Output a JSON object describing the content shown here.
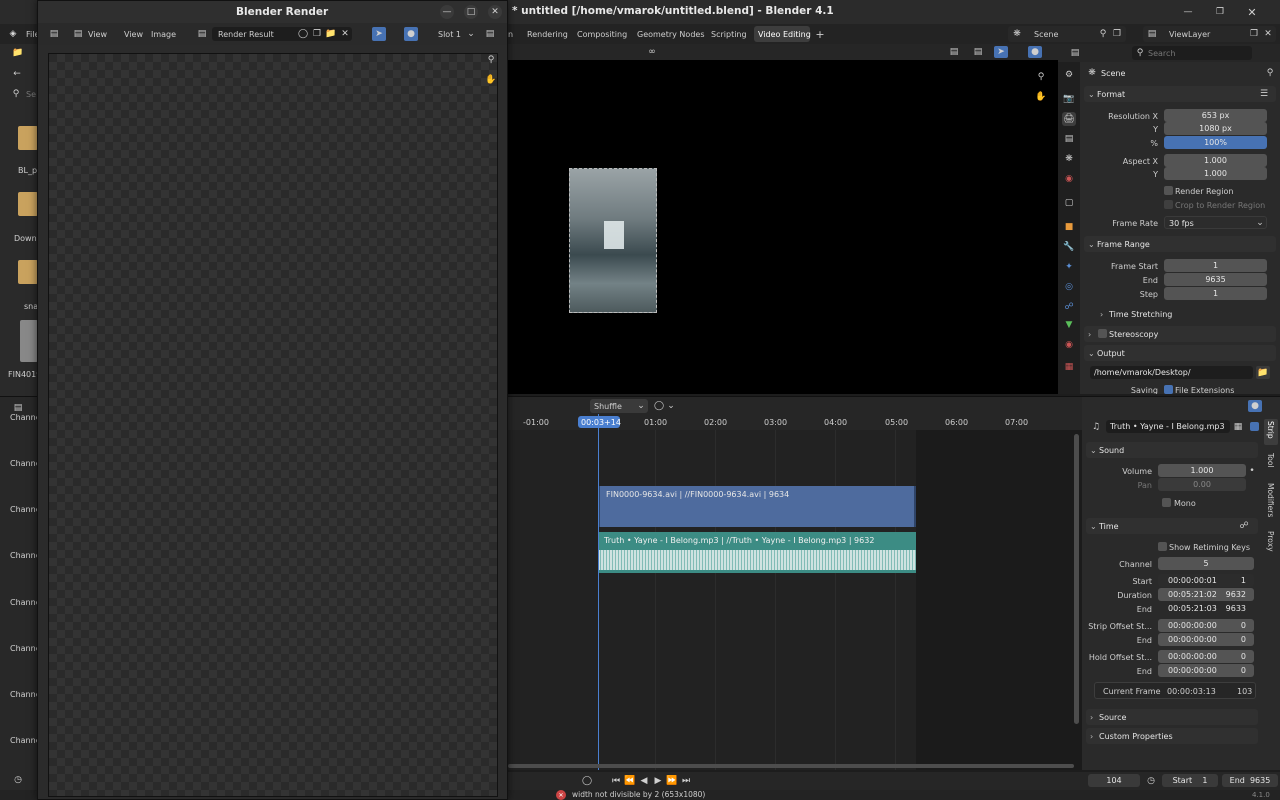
{
  "main_window": {
    "title": "* untitled [/home/vmarok/untitled.blend] - Blender 4.1",
    "workspaces": [
      "n",
      "Rendering",
      "Compositing",
      "Geometry Nodes",
      "Scripting",
      "Video Editing"
    ],
    "active_workspace": "Video Editing",
    "scene": "Scene",
    "view_layer": "ViewLayer"
  },
  "file_browser": {
    "menu_label": "File",
    "search_placeholder": "Se",
    "items": [
      "BL_pr",
      "Downl",
      "sna",
      "FIN4019"
    ]
  },
  "render_window": {
    "title": "Blender Render",
    "menu": [
      "View",
      "View",
      "Image"
    ],
    "image_name": "Render Result",
    "slot": "Slot 1"
  },
  "channels": {
    "labels": [
      "Channe",
      "Channe",
      "Channe",
      "Channe",
      "Channe",
      "Channe",
      "Channe",
      "Channe"
    ]
  },
  "preview": {
    "ruler_labels": [
      "-01:00",
      "01:00",
      "02:00",
      "03:00",
      "04:00",
      "05:00",
      "06:00",
      "07:00"
    ],
    "current_time": "00:03+14",
    "shuffle_label": "Shuffle"
  },
  "strips": {
    "video": "FIN0000-9634.avi | //FIN0000-9634.avi | 9634",
    "audio": "Truth • Yayne - I Belong.mp3 | //Truth • Yayne - I Belong.mp3 | 9632"
  },
  "properties": {
    "search_placeholder": "Search",
    "scene_name": "Scene",
    "format_header": "Format",
    "resolution_x_label": "Resolution X",
    "resolution_x": "653 px",
    "y_label": "Y",
    "resolution_y": "1080 px",
    "percent_label": "%",
    "percent": "100%",
    "aspect_x_label": "Aspect X",
    "aspect_x": "1.000",
    "aspect_y": "1.000",
    "render_region": "Render Region",
    "crop_region": "Crop to Render Region",
    "frame_rate_label": "Frame Rate",
    "frame_rate": "30 fps",
    "frame_range_header": "Frame Range",
    "frame_start_label": "Frame Start",
    "frame_start": "1",
    "end_label": "End",
    "frame_end": "9635",
    "step_label": "Step",
    "step": "1",
    "time_stretching": "Time Stretching",
    "stereoscopy": "Stereoscopy",
    "output_header": "Output",
    "output_path": "/home/vmarok/Desktop/",
    "saving_label": "Saving",
    "file_extensions": "File Extensions"
  },
  "strip_panel": {
    "strip_name": "Truth • Yayne - I Belong.mp3",
    "tabs": [
      "Strip",
      "Tool",
      "Modifiers",
      "Proxy"
    ],
    "sound_header": "Sound",
    "volume_label": "Volume",
    "volume": "1.000",
    "pan_label": "Pan",
    "pan": "0.00",
    "mono": "Mono",
    "time_header": "Time",
    "show_retiming": "Show Retiming Keys",
    "channel_label": "Channel",
    "channel": "5",
    "start_label": "Start",
    "start_tc": "00:00:00:01",
    "start_frame": "1",
    "duration_label": "Duration",
    "duration_tc": "00:05:21:02",
    "duration_frames": "9632",
    "end_label": "End",
    "end_tc": "00:05:21:03",
    "end_frame": "9633",
    "strip_offset_start_label": "Strip Offset St...",
    "strip_offset_start_tc": "00:00:00:00",
    "strip_offset_start": "0",
    "strip_offset_end_label": "End",
    "strip_offset_end_tc": "00:00:00:00",
    "strip_offset_end": "0",
    "hold_offset_start_label": "Hold Offset St...",
    "hold_offset_start_tc": "00:00:00:00",
    "hold_offset_start": "0",
    "hold_offset_end_label": "End",
    "hold_offset_end_tc": "00:00:00:00",
    "hold_offset_end": "0",
    "current_frame_label": "Current Frame",
    "current_frame_tc": "00:00:03:13",
    "current_frame": "103",
    "source_header": "Source",
    "custom_props_header": "Custom Properties"
  },
  "footer": {
    "current_frame": "104",
    "start_label": "Start",
    "start": "1",
    "end_label": "End",
    "end": "9635",
    "version": "4.1.0",
    "status_message": "width not divisible by 2 (653x1080)"
  }
}
